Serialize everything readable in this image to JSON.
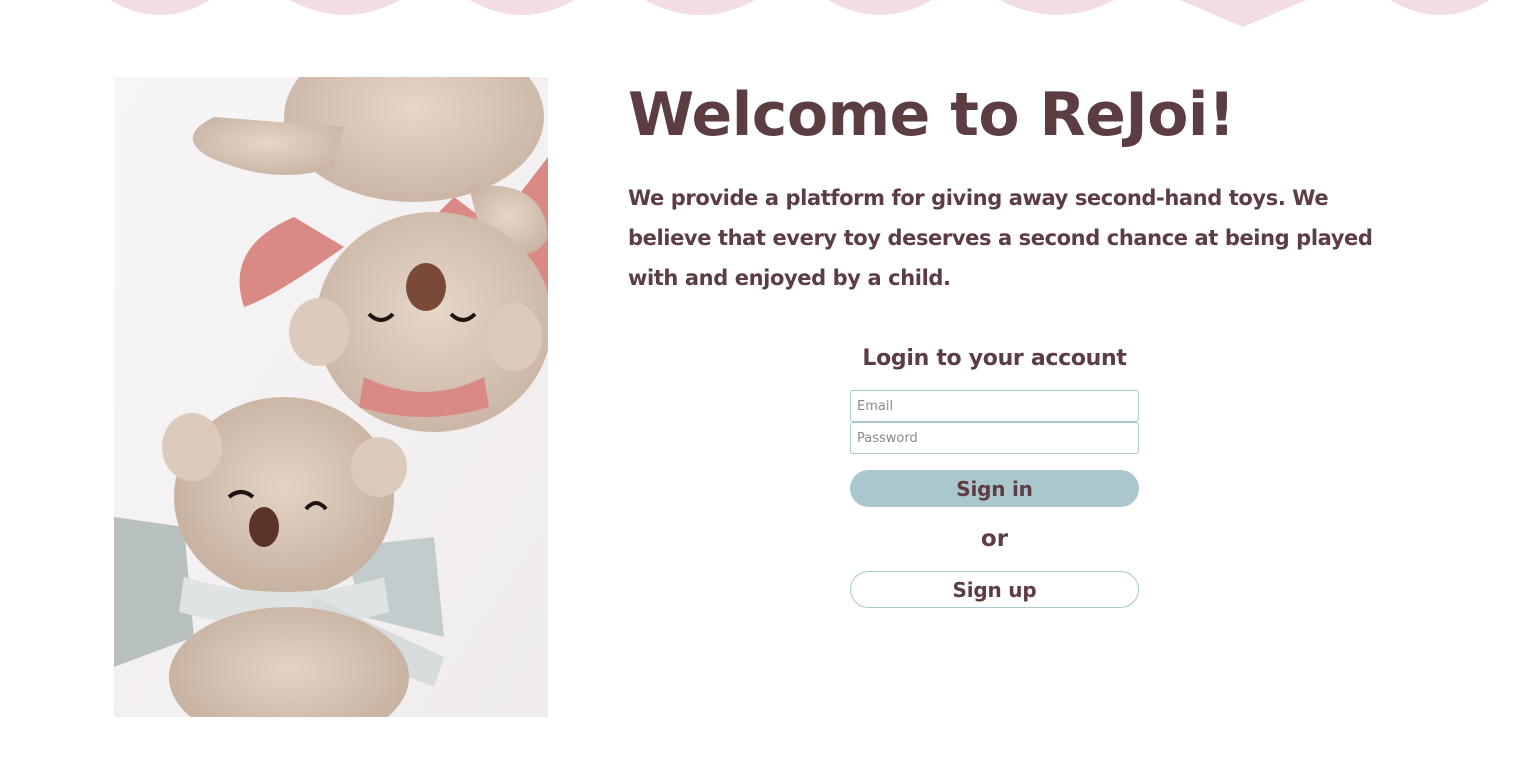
{
  "hero": {
    "title": "Welcome to ReJoi!",
    "description": "We provide a platform for giving away second-hand toys. We believe that every toy deserves a second chance at being played with and enjoyed by a child."
  },
  "login": {
    "heading": "Login to your account",
    "email_placeholder": "Email",
    "password_placeholder": "Password",
    "signin_label": "Sign in",
    "or_label": "or",
    "signup_label": "Sign up"
  },
  "image": {
    "subject": "two plush teddy bears lying on a white surface"
  },
  "colors": {
    "text": "#5c3d42",
    "accent": "#a9c7cd",
    "wave": "#f2dde3",
    "background": "#ffffff"
  }
}
